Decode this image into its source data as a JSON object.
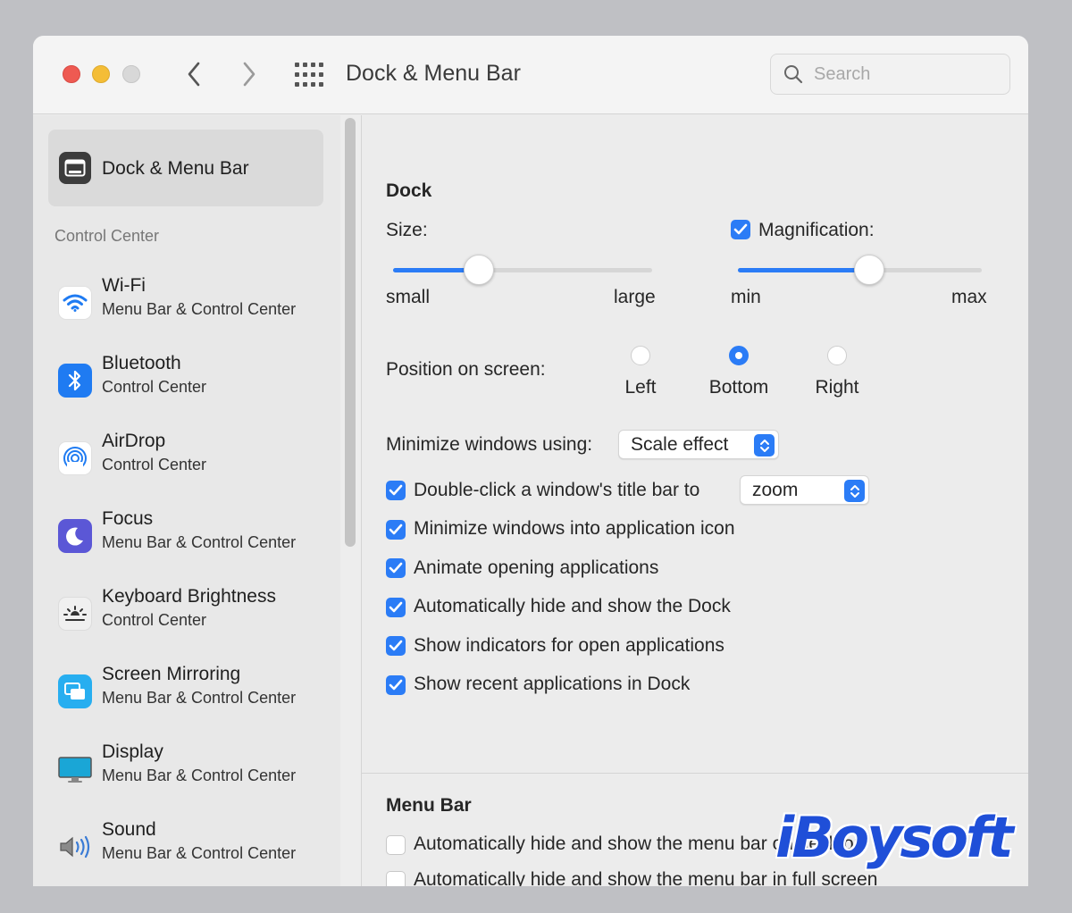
{
  "window": {
    "title": "Dock & Menu Bar",
    "search_placeholder": "Search"
  },
  "sidebar": {
    "selected_label": "Dock & Menu Bar",
    "section_header": "Control Center",
    "items": [
      {
        "title": "Wi-Fi",
        "subtitle": "Menu Bar & Control Center",
        "icon": "wifi-icon"
      },
      {
        "title": "Bluetooth",
        "subtitle": "Control Center",
        "icon": "bluetooth-icon"
      },
      {
        "title": "AirDrop",
        "subtitle": "Control Center",
        "icon": "airdrop-icon"
      },
      {
        "title": "Focus",
        "subtitle": "Menu Bar & Control Center",
        "icon": "moon-icon"
      },
      {
        "title": "Keyboard Brightness",
        "subtitle": "Control Center",
        "icon": "keyboard-brightness-icon"
      },
      {
        "title": "Screen Mirroring",
        "subtitle": "Menu Bar & Control Center",
        "icon": "screen-mirroring-icon"
      },
      {
        "title": "Display",
        "subtitle": "Menu Bar & Control Center",
        "icon": "display-icon"
      },
      {
        "title": "Sound",
        "subtitle": "Menu Bar & Control Center",
        "icon": "speaker-icon"
      }
    ]
  },
  "dock": {
    "header": "Dock",
    "size_label": "Size:",
    "size_min": "small",
    "size_max": "large",
    "size_level": 0.33,
    "magnification_label": "Magnification:",
    "magnification_checked": true,
    "magnification_min": "min",
    "magnification_max": "max",
    "magnification_level": 0.54,
    "position_label": "Position on screen:",
    "positions": [
      "Left",
      "Bottom",
      "Right"
    ],
    "position_selected": "Bottom",
    "minimize_label": "Minimize windows using:",
    "minimize_value": "Scale effect",
    "double_click_label": "Double-click a window's title bar to",
    "double_click_value": "zoom",
    "double_click_checked": true,
    "checkboxes": [
      {
        "label": "Minimize windows into application icon",
        "checked": true
      },
      {
        "label": "Animate opening applications",
        "checked": true
      },
      {
        "label": "Automatically hide and show the Dock",
        "checked": true
      },
      {
        "label": "Show indicators for open applications",
        "checked": true
      },
      {
        "label": "Show recent applications in Dock",
        "checked": true
      }
    ]
  },
  "menu_bar": {
    "header": "Menu Bar",
    "checkboxes": [
      {
        "label": "Automatically hide and show the menu bar on desktop",
        "checked": false
      },
      {
        "label": "Automatically hide and show the menu bar in full screen",
        "checked": false
      }
    ]
  },
  "watermark": "iBoysoft",
  "colors": {
    "accent": "#2b7cf6",
    "close": "#ee5a52",
    "minimize": "#f4bd36",
    "zoom_disabled": "#d8d8d8"
  }
}
